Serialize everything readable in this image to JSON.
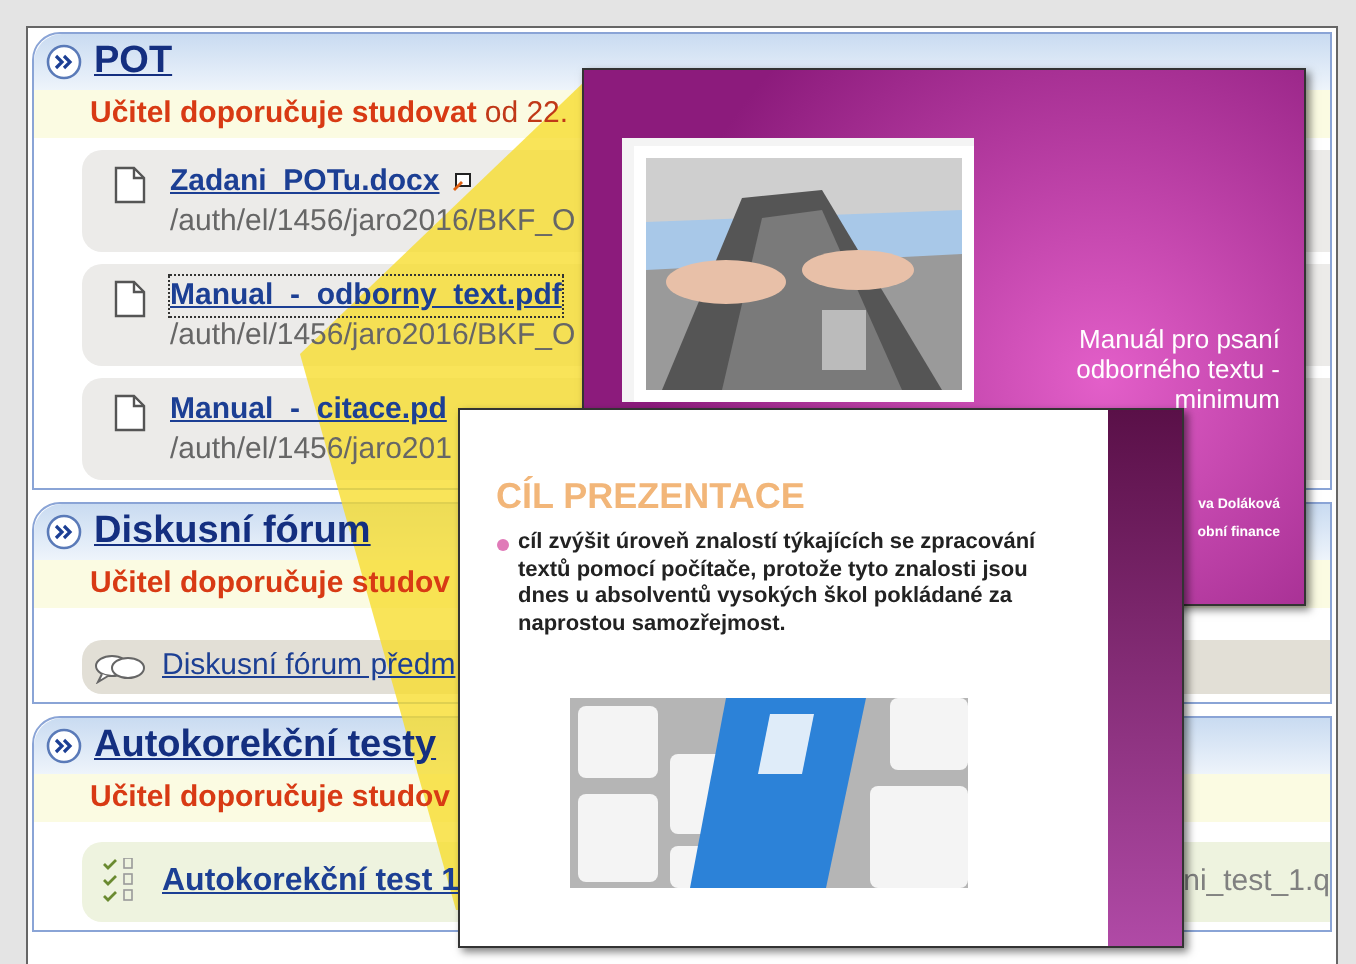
{
  "sections": [
    {
      "title": "POT",
      "recommendation": {
        "label": "Učitel doporučuje studovat",
        "detail": "od 22."
      },
      "items": [
        {
          "kind": "file",
          "name": "Zadani_POTu.docx",
          "path": "/auth/el/1456/jaro2016/BKF_O",
          "external": true,
          "focused": false
        },
        {
          "kind": "file",
          "name": "Manual_-_odborny_text.pdf",
          "path": "/auth/el/1456/jaro2016/BKF_O",
          "external": false,
          "focused": true
        },
        {
          "kind": "file",
          "name": "Manual_-_citace.pd",
          "path": "/auth/el/1456/jaro201",
          "external": false,
          "focused": false
        }
      ]
    },
    {
      "title": "Diskusní fórum",
      "recommendation": {
        "label": "Učitel doporučuje studov"
      },
      "items": [
        {
          "kind": "forum",
          "name": "Diskusní fórum předm"
        }
      ]
    },
    {
      "title": "Autokorekční testy",
      "recommendation": {
        "label": "Učitel doporučuje studov"
      },
      "items": [
        {
          "kind": "test",
          "name": "Autokorekční test 1",
          "path_tail": "ni_test_1.q"
        }
      ]
    }
  ],
  "previews": [
    {
      "kind": "title_slide",
      "title": "Manuál pro psaní odborného textu - minimum",
      "lines": [
        "va Doláková",
        "obní finance"
      ]
    },
    {
      "kind": "content_slide",
      "heading": "CÍL PREZENTACE",
      "bullets": [
        "cíl zvýšit úroveň znalostí týkajících se zpracování textů pomocí počítače, protože tyto znalosti jsou dnes u absolventů vysokých škol pokládané za naprostou samozřejmost."
      ]
    }
  ]
}
